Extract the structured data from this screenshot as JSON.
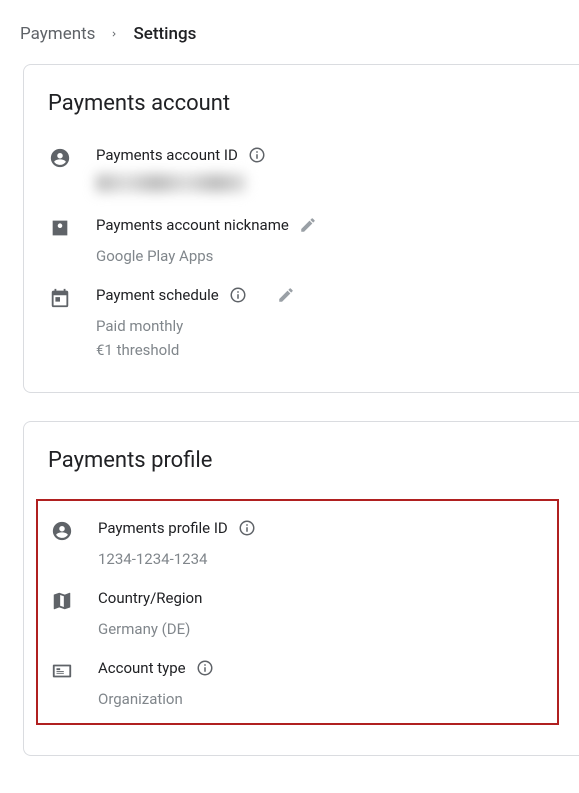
{
  "breadcrumb": {
    "parent": "Payments",
    "current": "Settings"
  },
  "account_card": {
    "title": "Payments account",
    "rows": {
      "account_id": {
        "label": "Payments account ID"
      },
      "nickname": {
        "label": "Payments account nickname",
        "value": "Google Play Apps"
      },
      "schedule": {
        "label": "Payment schedule",
        "value1": "Paid monthly",
        "value2": "€1 threshold"
      }
    }
  },
  "profile_card": {
    "title": "Payments profile",
    "rows": {
      "profile_id": {
        "label": "Payments profile ID",
        "value": "1234-1234-1234"
      },
      "country": {
        "label": "Country/Region",
        "value": "Germany (DE)"
      },
      "account_type": {
        "label": "Account type",
        "value": "Organization"
      }
    }
  }
}
